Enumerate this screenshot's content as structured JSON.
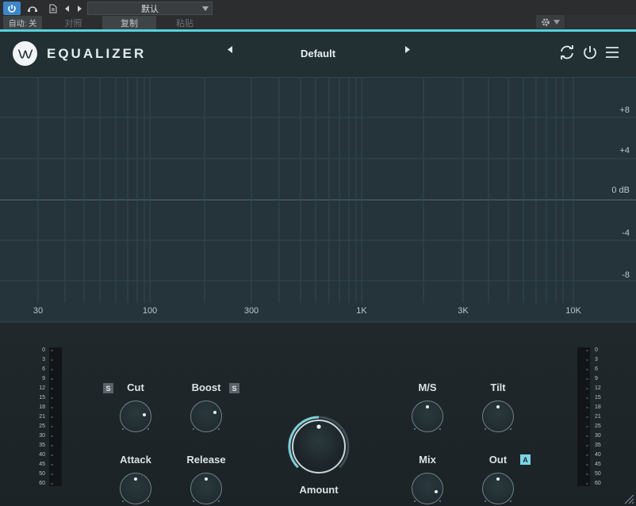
{
  "host": {
    "auto_label": "自动: 关",
    "compare_label": "对照",
    "copy_label": "复制",
    "paste_label": "粘贴",
    "preset_name": "默认"
  },
  "plugin": {
    "title": "EQUALIZER",
    "preset": "Default"
  },
  "graph": {
    "db_labels": [
      "+8",
      "+4",
      "0 dB",
      "-4",
      "-8"
    ],
    "freq_labels": [
      "30",
      "100",
      "300",
      "1K",
      "3K",
      "10K"
    ]
  },
  "controls": {
    "knobs": [
      {
        "label": "Cut",
        "solo": "S",
        "value": 0.8
      },
      {
        "label": "Boost",
        "solo": "S",
        "value": 0.75
      },
      {
        "label": "Attack",
        "value": 0.5
      },
      {
        "label": "Release",
        "value": 0.5
      },
      {
        "label": "M/S",
        "value": 0.5
      },
      {
        "label": "Tilt",
        "value": 0.5
      },
      {
        "label": "Mix",
        "value": 0.92
      },
      {
        "label": "Out",
        "auto": "A",
        "value": 0.5
      }
    ],
    "amount": {
      "label": "Amount",
      "value": 0.5
    },
    "meter_scale": [
      "0",
      "3",
      "6",
      "9",
      "12",
      "15",
      "18",
      "21",
      "25",
      "30",
      "35",
      "40",
      "45",
      "50",
      "60"
    ]
  },
  "colors": {
    "accent": "#55d2dc",
    "panel": "#233034",
    "graph": "#24343a"
  }
}
